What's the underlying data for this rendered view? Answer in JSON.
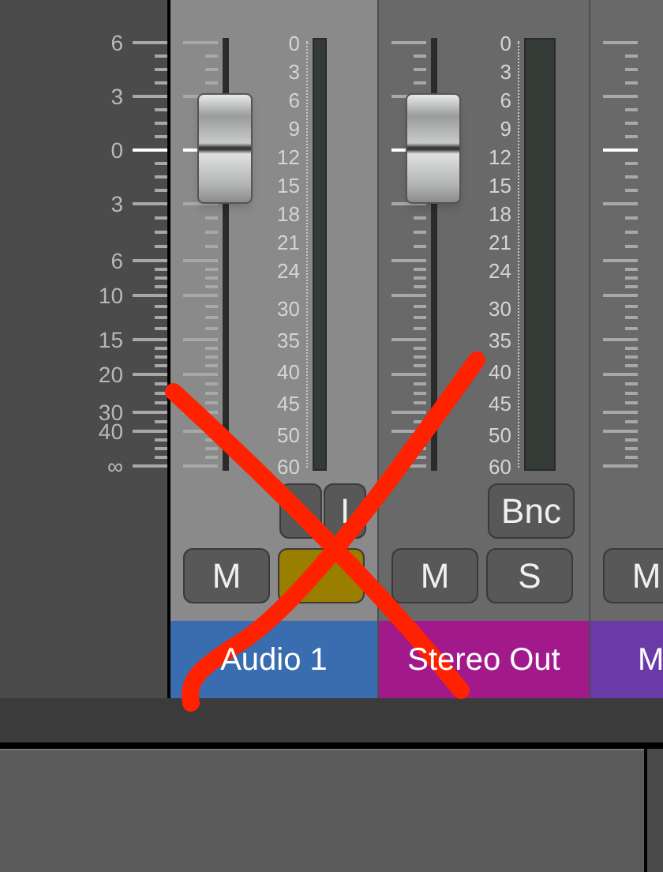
{
  "scale": [
    "6",
    "3",
    "0",
    "3",
    "6",
    "10",
    "15",
    "20",
    "30",
    "40",
    "∞"
  ],
  "strips": [
    {
      "name": "Audio 1",
      "selected": true,
      "color": "#3a6db0",
      "fader": {
        "level": 0.75
      },
      "meter": {
        "level": 0
      },
      "meter_scale": [
        "0",
        "3",
        "6",
        "9",
        "12",
        "15",
        "18",
        "21",
        "24",
        "30",
        "35",
        "40",
        "45",
        "50",
        "60"
      ],
      "top_buttons": [
        {
          "kind": "record",
          "on": false
        },
        {
          "label": "I",
          "kind": "input",
          "on": false
        }
      ],
      "mute": {
        "label": "M",
        "on": false
      },
      "solo": {
        "on": true
      }
    },
    {
      "name": "Stereo Out",
      "selected": false,
      "color": "#a2198c",
      "fader": {
        "level": 0.75
      },
      "meter": {
        "level": 0
      },
      "meter_scale": [
        "0",
        "3",
        "6",
        "9",
        "12",
        "15",
        "18",
        "21",
        "24",
        "30",
        "35",
        "40",
        "45",
        "50",
        "60"
      ],
      "top_buttons": [
        {
          "label": "Bnc",
          "kind": "bounce",
          "on": false
        }
      ],
      "mute": {
        "label": "M",
        "on": false
      },
      "solo": {
        "label": "S",
        "on": false
      }
    },
    {
      "name": "M",
      "selected": false,
      "color": "#6a3aa8",
      "mute": {
        "label": "M",
        "on": false
      }
    }
  ],
  "overlay": {
    "kind": "cross"
  }
}
